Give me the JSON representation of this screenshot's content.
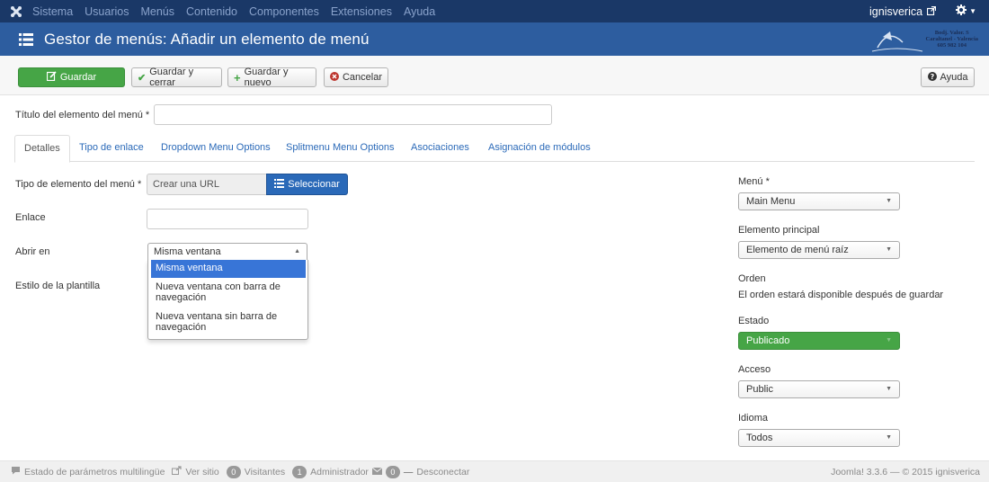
{
  "nav": {
    "items": [
      "Sistema",
      "Usuarios",
      "Menús",
      "Contenido",
      "Componentes",
      "Extensiones",
      "Ayuda"
    ],
    "user": "ignisverica"
  },
  "header": {
    "title": "Gestor de menús: Añadir un elemento de menú",
    "brand_lines": [
      "Bodj. Valor. S",
      "Caraltanel - Valencia",
      "605 982 104"
    ]
  },
  "toolbar": {
    "save": "Guardar",
    "save_close": "Guardar y cerrar",
    "save_new": "Guardar y nuevo",
    "cancel": "Cancelar",
    "help": "Ayuda"
  },
  "form": {
    "title_label": "Título del elemento del menú *",
    "title_value": ""
  },
  "tabs": [
    "Detalles",
    "Tipo de enlace",
    "Dropdown Menu Options",
    "Splitmenu Menu Options",
    "Asociaciones",
    "Asignación de módulos"
  ],
  "details": {
    "type_label": "Tipo de elemento del menú *",
    "type_value": "Crear una URL",
    "select_button": "Seleccionar",
    "link_label": "Enlace",
    "link_value": "",
    "open_label": "Abrir en",
    "open_value": "Misma ventana",
    "open_options": [
      "Misma ventana",
      "Nueva ventana con barra de navegación",
      "Nueva ventana sin barra de navegación"
    ],
    "template_label": "Estilo de la plantilla"
  },
  "sidebar": {
    "menu_label": "Menú *",
    "menu_value": "Main Menu",
    "parent_label": "Elemento principal",
    "parent_value": "Elemento de menú raíz",
    "order_label": "Orden",
    "order_text": "El orden estará disponible después de guardar",
    "status_label": "Estado",
    "status_value": "Publicado",
    "access_label": "Acceso",
    "access_value": "Public",
    "language_label": "Idioma",
    "language_value": "Todos"
  },
  "footer": {
    "multilang": "Estado de parámetros multilingüe",
    "view_site": "Ver sitio",
    "visitors_count": "0",
    "visitors": "Visitantes",
    "admin_count": "1",
    "admin": "Administrador",
    "messages_count": "0",
    "logout": "Desconectar",
    "version": "Joomla! 3.3.6 — © 2015 ignisverica"
  },
  "colors": {
    "nav_bg": "#1a3867",
    "header_bg": "#2d5d9f",
    "primary": "#2a69b8",
    "success": "#46a546",
    "danger": "#bd362f"
  }
}
